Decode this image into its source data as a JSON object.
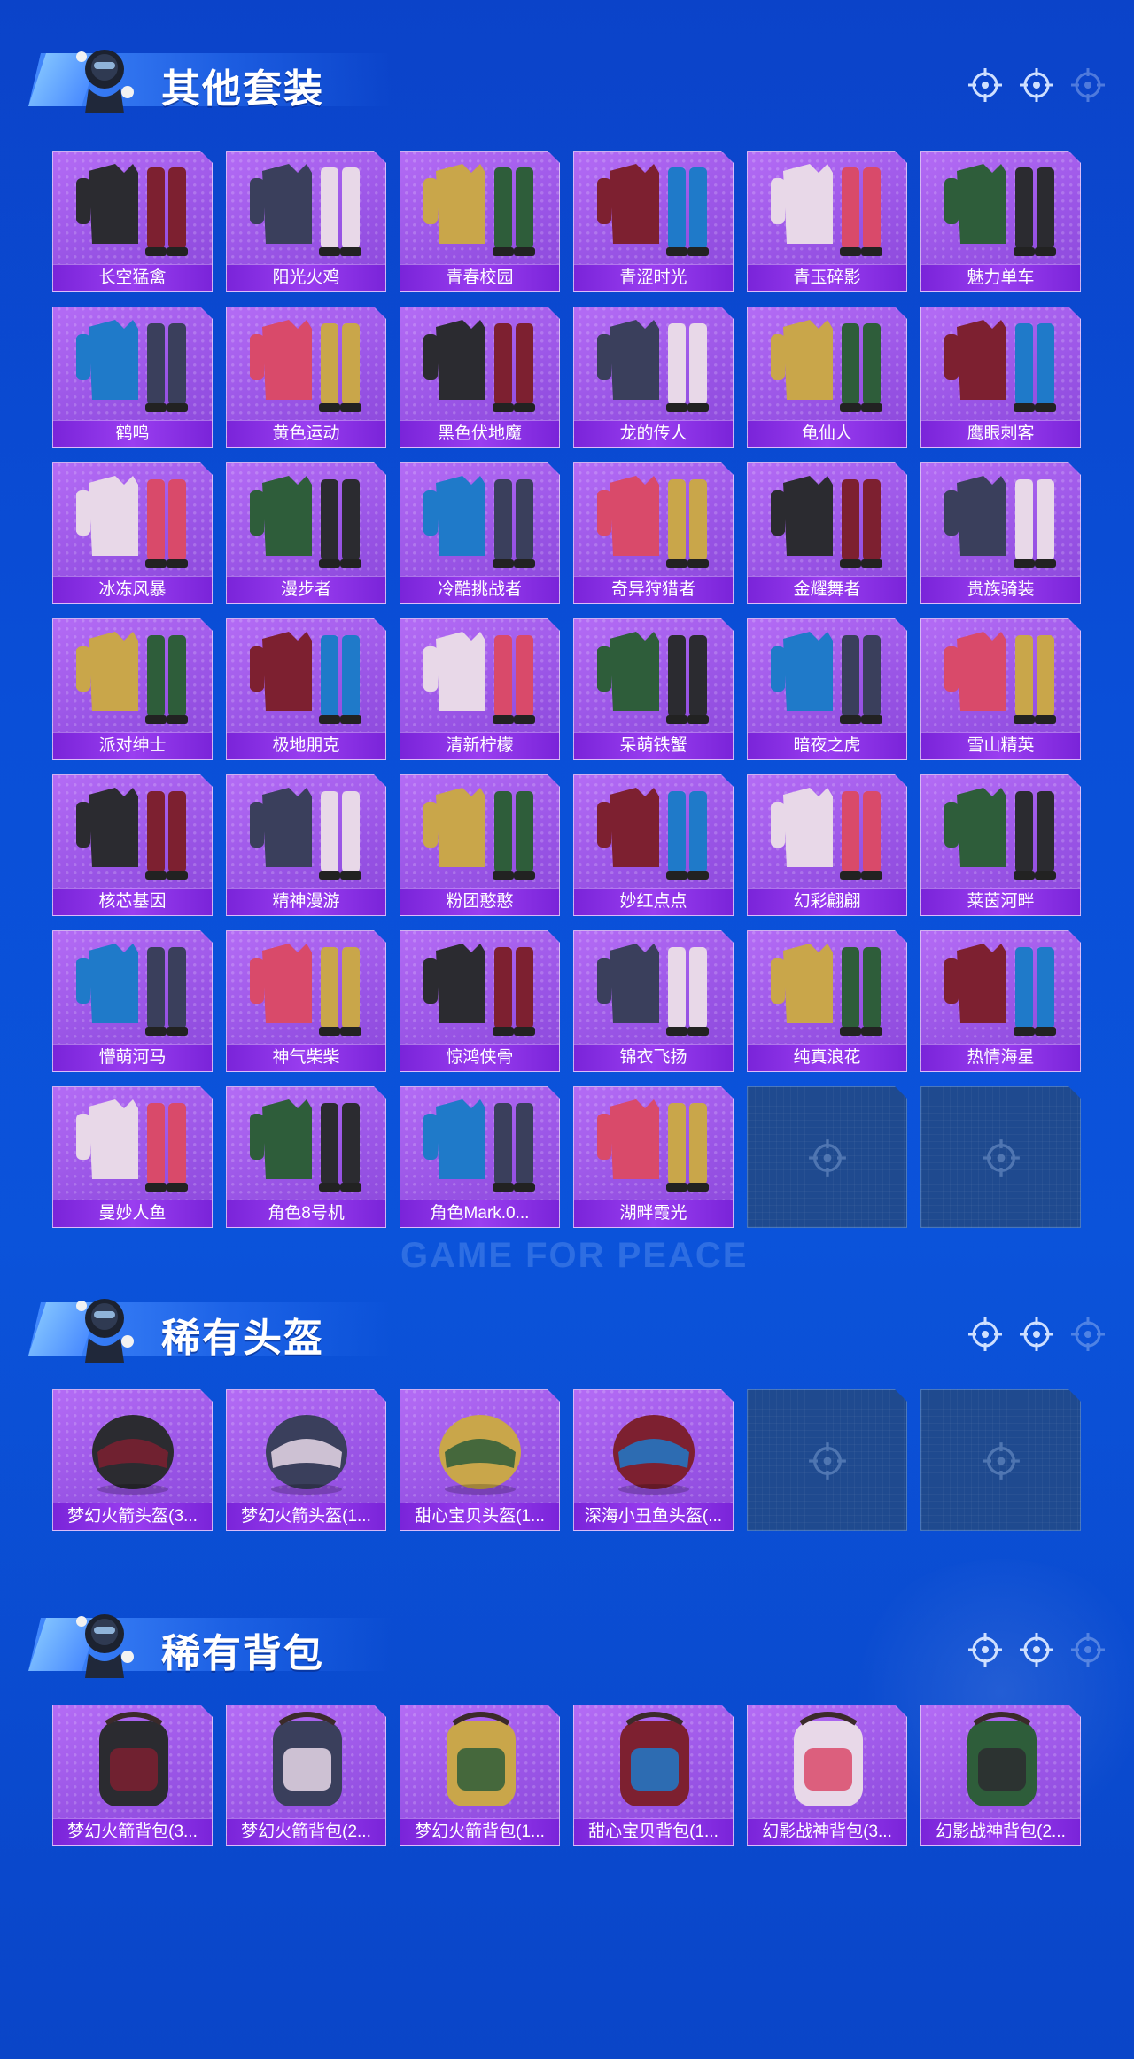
{
  "sections": {
    "suits": {
      "title": "其他套装",
      "items": [
        {
          "label": "长空猛禽"
        },
        {
          "label": "阳光火鸡"
        },
        {
          "label": "青春校园"
        },
        {
          "label": "青涩时光"
        },
        {
          "label": "青玉碎影"
        },
        {
          "label": "魅力单车"
        },
        {
          "label": "鹤鸣"
        },
        {
          "label": "黄色运动"
        },
        {
          "label": "黑色伏地魔"
        },
        {
          "label": "龙的传人"
        },
        {
          "label": "龟仙人"
        },
        {
          "label": "鹰眼刺客"
        },
        {
          "label": "冰冻风暴"
        },
        {
          "label": "漫步者"
        },
        {
          "label": "冷酷挑战者"
        },
        {
          "label": "奇异狩猎者"
        },
        {
          "label": "金耀舞者"
        },
        {
          "label": "贵族骑装"
        },
        {
          "label": "派对绅士"
        },
        {
          "label": "极地朋克"
        },
        {
          "label": "清新柠檬"
        },
        {
          "label": "呆萌铁蟹"
        },
        {
          "label": "暗夜之虎"
        },
        {
          "label": "雪山精英"
        },
        {
          "label": "核芯基因"
        },
        {
          "label": "精神漫游"
        },
        {
          "label": "粉团憨憨"
        },
        {
          "label": "妙红点点"
        },
        {
          "label": "幻彩翩翩"
        },
        {
          "label": "莱茵河畔"
        },
        {
          "label": "懵萌河马"
        },
        {
          "label": "神气柴柴"
        },
        {
          "label": "惊鸿侠骨"
        },
        {
          "label": "锦衣飞扬"
        },
        {
          "label": "纯真浪花"
        },
        {
          "label": "热情海星"
        },
        {
          "label": "曼妙人鱼"
        },
        {
          "label": "角色8号机"
        },
        {
          "label": "角色Mark.0..."
        },
        {
          "label": "湖畔霞光"
        }
      ]
    },
    "helmets": {
      "title": "稀有头盔",
      "items": [
        {
          "label": "梦幻火箭头盔(3..."
        },
        {
          "label": "梦幻火箭头盔(1..."
        },
        {
          "label": "甜心宝贝头盔(1..."
        },
        {
          "label": "深海小丑鱼头盔(..."
        }
      ]
    },
    "backpacks": {
      "title": "稀有背包",
      "items": [
        {
          "label": "梦幻火箭背包(3..."
        },
        {
          "label": "梦幻火箭背包(2..."
        },
        {
          "label": "梦幻火箭背包(1..."
        },
        {
          "label": "甜心宝贝背包(1..."
        },
        {
          "label": "幻影战神背包(3..."
        },
        {
          "label": "幻影战神背包(2..."
        }
      ]
    }
  },
  "watermark": "GAME FOR PEACE",
  "colors": {
    "background": "#0b4fd6",
    "card_purple": "#9a55e6",
    "label_bar": "#8a2fe6",
    "empty_slot": "#1f4a8f"
  }
}
